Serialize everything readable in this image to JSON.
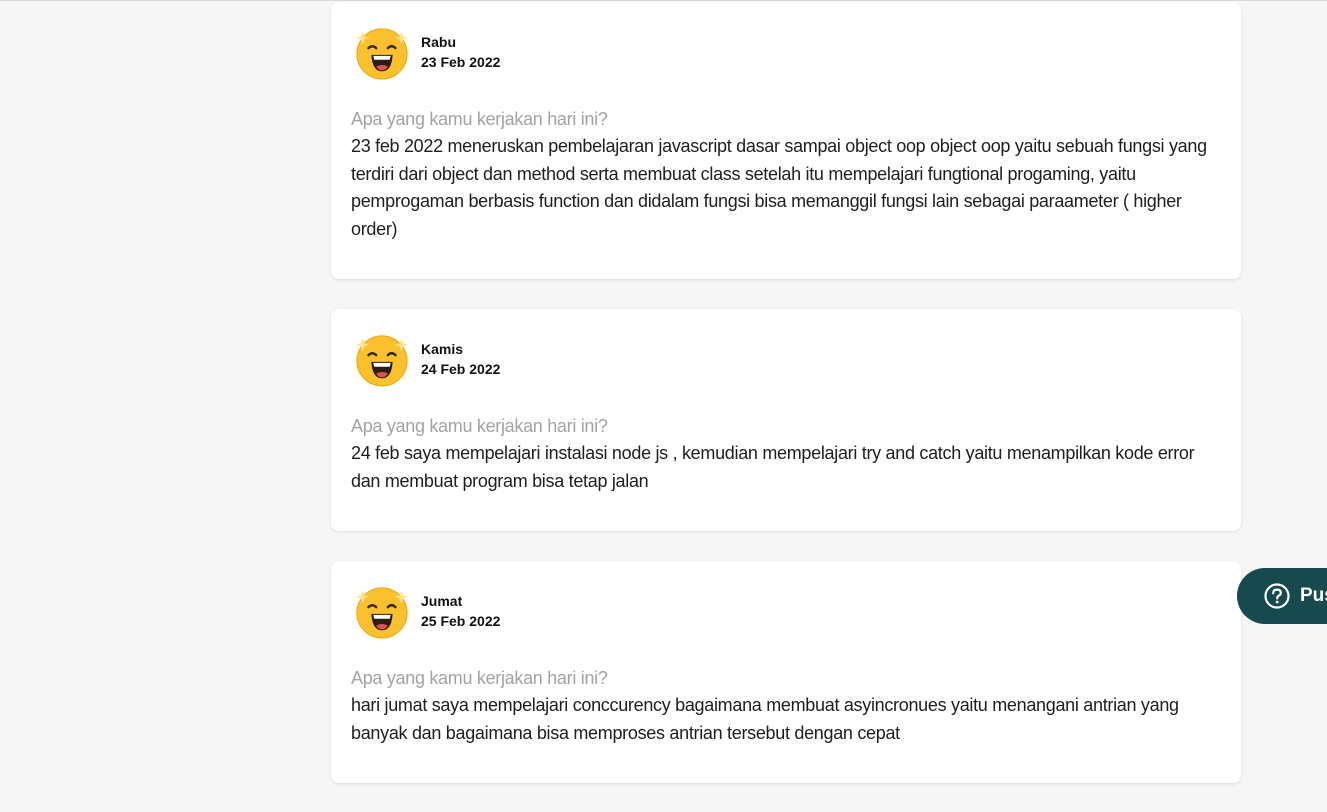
{
  "journal": {
    "entries": [
      {
        "day": "Rabu",
        "date": "23 Feb 2022",
        "mood_icon": "grinning-face-with-stars-icon",
        "question": "Apa yang kamu kerjakan hari ini?",
        "answer": "23 feb 2022 meneruskan pembelajaran javascript dasar sampai object oop object oop yaitu sebuah fungsi yang terdiri dari object dan method serta membuat class  setelah itu mempelajari fungtional progaming, yaitu pemprogaman berbasis function dan didalam fungsi bisa memanggil fungsi lain sebagai paraameter ( higher order)"
      },
      {
        "day": "Kamis",
        "date": "24 Feb 2022",
        "mood_icon": "grinning-face-with-stars-icon",
        "question": "Apa yang kamu kerjakan hari ini?",
        "answer": "24 feb saya mempelajari instalasi node js , kemudian mempelajari try and catch yaitu menampilkan kode error dan membuat program bisa tetap jalan"
      },
      {
        "day": "Jumat",
        "date": "25 Feb 2022",
        "mood_icon": "grinning-face-with-stars-icon",
        "question": "Apa yang kamu kerjakan hari ini?",
        "answer": "hari jumat saya mempelajari conccurency bagaimana membuat asyincronues yaitu menangani antrian yang banyak dan bagaimana bisa memproses antrian tersebut dengan cepat"
      }
    ]
  },
  "help_button": {
    "label": "Pus",
    "icon": "question-circle-icon"
  },
  "colors": {
    "background": "#f6f6f6",
    "card": "#ffffff",
    "question_text": "#a3a3a3",
    "answer_text": "#1e1e1e",
    "help_button": "#164a4e",
    "emoji_face": "#fbc02d"
  }
}
